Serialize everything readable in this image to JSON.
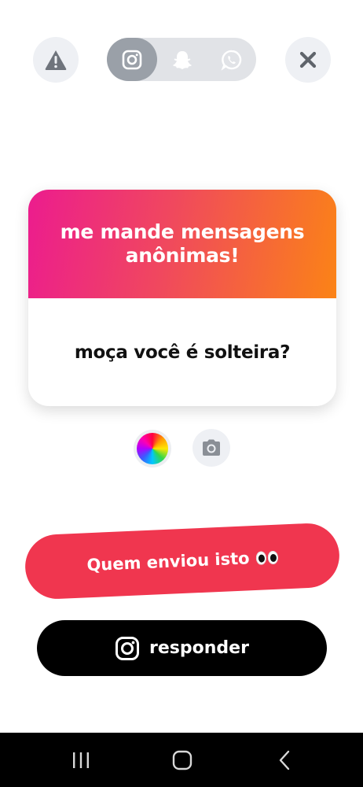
{
  "card": {
    "title": "me mande mensagens anônimas!",
    "question": "moça você é solteira?"
  },
  "buttons": {
    "who_sent": "Quem enviou isto",
    "reply": "responder"
  },
  "colors": {
    "card_gradient": [
      "#ec1c8e",
      "#fb8316"
    ],
    "who_button": "#f0364f",
    "reply_button": "#000000"
  },
  "icons": {
    "top": [
      "warning-icon",
      "instagram-icon",
      "snapchat-icon",
      "whatsapp-icon",
      "close-icon"
    ],
    "nav": [
      "recents-icon",
      "home-icon",
      "back-icon"
    ]
  }
}
